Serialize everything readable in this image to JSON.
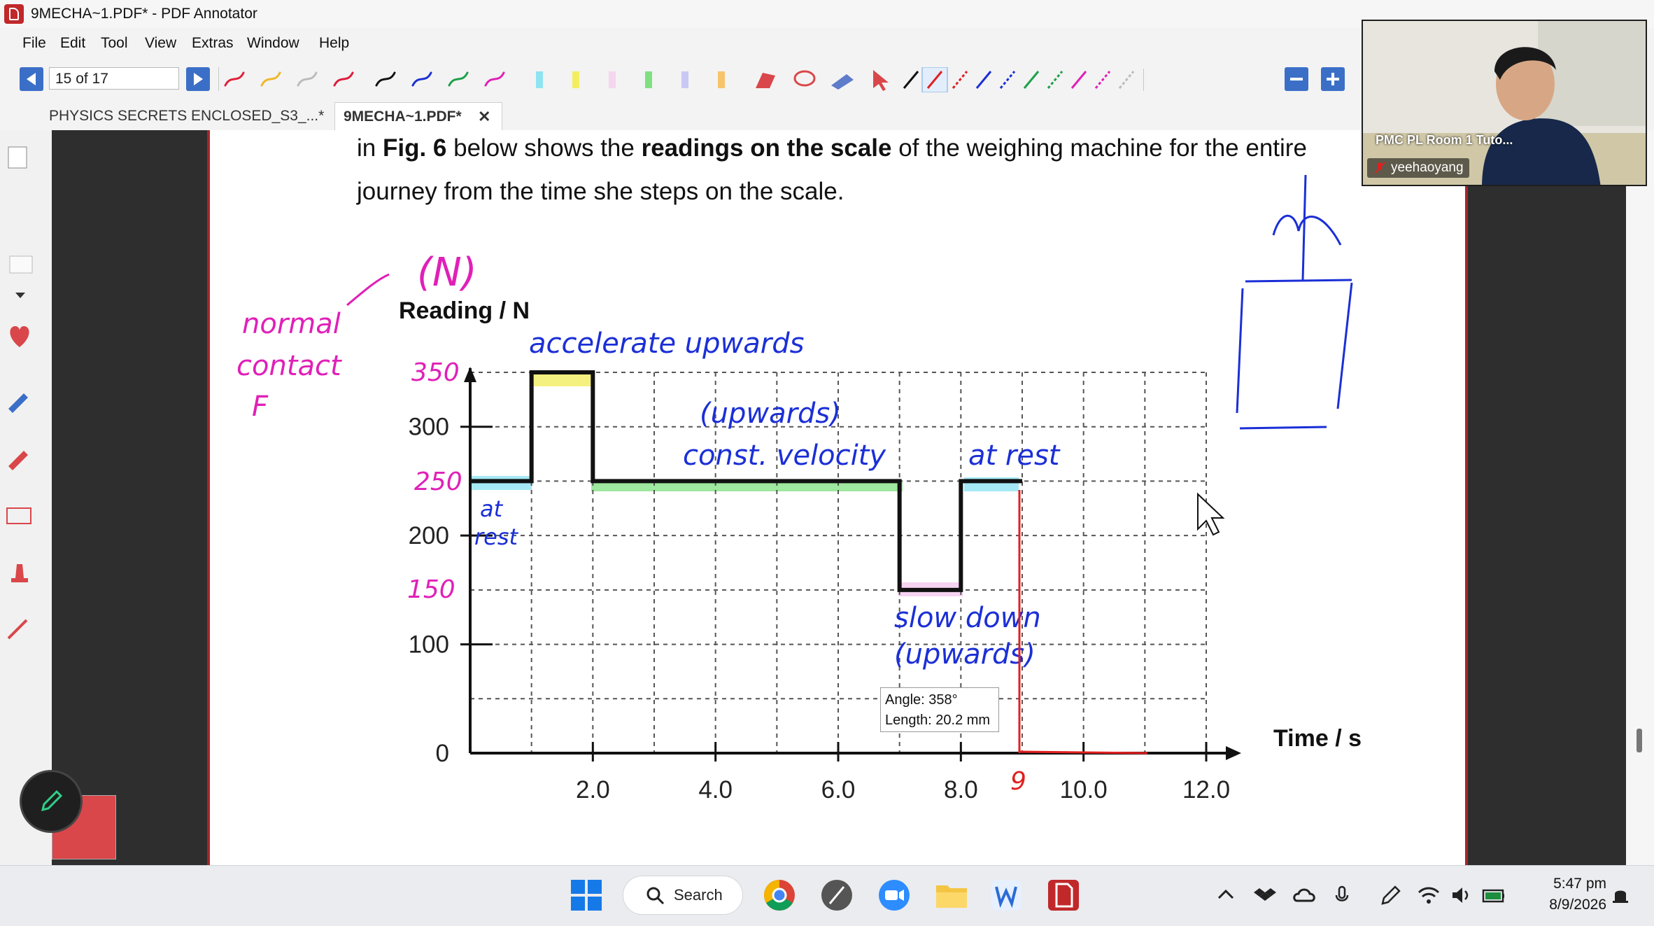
{
  "window": {
    "title": "9MECHA~1.PDF* - PDF Annotator"
  },
  "menu": {
    "items": [
      "File",
      "Edit",
      "Tool",
      "View",
      "Extras",
      "Window",
      "Help"
    ]
  },
  "toolbar": {
    "page_indicator": "15 of 17"
  },
  "tabs": [
    {
      "label": "PHYSICS SECRETS ENCLOSED_S3_...*",
      "active": false
    },
    {
      "label": "9MECHA~1.PDF*",
      "active": true,
      "close": "✕"
    }
  ],
  "document": {
    "line1_pre": "in ",
    "line1_bold1": "Fig. 6",
    "line1_mid": " below shows the ",
    "line1_bold2": "readings on the scale",
    "line1_post": " of the weighing machine for the entire",
    "line2": "journey from the time she steps on the scale."
  },
  "chart_data": {
    "type": "line",
    "ylabel": "Reading / N",
    "xlabel": "Time / s",
    "x_ticks": [
      "2.0",
      "4.0",
      "6.0",
      "8.0",
      "10.0",
      "12.0"
    ],
    "y_ticks": [
      "0",
      "100",
      "200",
      "300"
    ],
    "xlim": [
      0,
      12
    ],
    "ylim": [
      0,
      350
    ],
    "grid": true,
    "series": [
      {
        "x": [
          0,
          1,
          1,
          2,
          2,
          7,
          7,
          8,
          8,
          9
        ],
        "y": [
          250,
          250,
          350,
          350,
          250,
          250,
          150,
          150,
          250,
          250
        ]
      }
    ]
  },
  "annotations": {
    "unit_n": "(N)",
    "normal": "normal",
    "contact": "contact",
    "f": "F",
    "y350": "350",
    "y250": "250",
    "y150": "150",
    "accelerate_upwards": "accelerate upwards",
    "upwards": "(upwards)",
    "const_velocity": "const. velocity",
    "at_rest_right": "at rest",
    "at_rest_left_1": "at",
    "at_rest_left_2": "rest",
    "slow_down": "slow down",
    "upwards_2": "(upwards)",
    "x9": "9"
  },
  "tooltip": {
    "angle": "Angle: 358°",
    "length": "Length: 20.2 mm"
  },
  "video": {
    "room": "PMC PL Room 1 Tuto...",
    "user": "yeehaoyang"
  },
  "taskbar": {
    "search": "Search",
    "time": "5:47 pm",
    "date": "8/9/2026"
  },
  "colors": {
    "accent_red": "#c0282a",
    "nav_blue": "#3b6fc7",
    "ink_blue": "#1b2fd6",
    "ink_magenta": "#e020b8",
    "ink_red": "#e02020",
    "highlight_green": "#7fe07f",
    "highlight_cyan": "#8fe3f2",
    "highlight_yellow": "#f2ee60",
    "highlight_pink": "#f5c9ee"
  }
}
